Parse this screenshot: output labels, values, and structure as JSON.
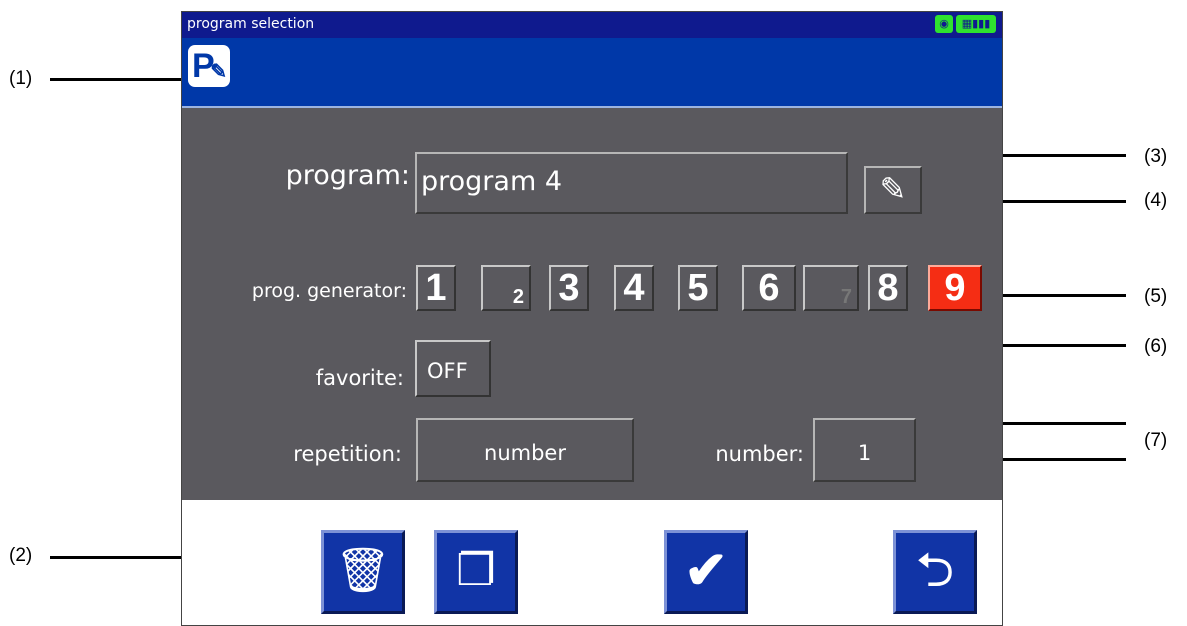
{
  "callouts": [
    "(1)",
    "(2)",
    "(3)",
    "(4)",
    "(5)",
    "(6)",
    "(7)"
  ],
  "titlebar": {
    "title": "program selection",
    "status_icons": [
      "running-indicator-icon",
      "battery-status-icon"
    ]
  },
  "header": {
    "icon": "program-edit-icon"
  },
  "form": {
    "program_label": "program:",
    "program_value": "program 4",
    "edit_icon": "pencil-icon",
    "generator_label": "prog. generator:",
    "generator_buttons": [
      "1",
      "2",
      "3",
      "4",
      "5",
      "6",
      "7",
      "8",
      "9"
    ],
    "generator_selected": "9",
    "favorite_label": "favorite:",
    "favorite_value": "OFF",
    "repetition_label": "repetition:",
    "repetition_value": "number",
    "number_label": "number:",
    "number_value": "1"
  },
  "actions": [
    "delete-icon",
    "copy-icon",
    "confirm-icon",
    "back-icon"
  ],
  "colors": {
    "titlebar": "#0f1a8e",
    "header": "#0038a8",
    "panel": "#5a595e",
    "selected": "#f52d14",
    "action": "#1134a6"
  }
}
